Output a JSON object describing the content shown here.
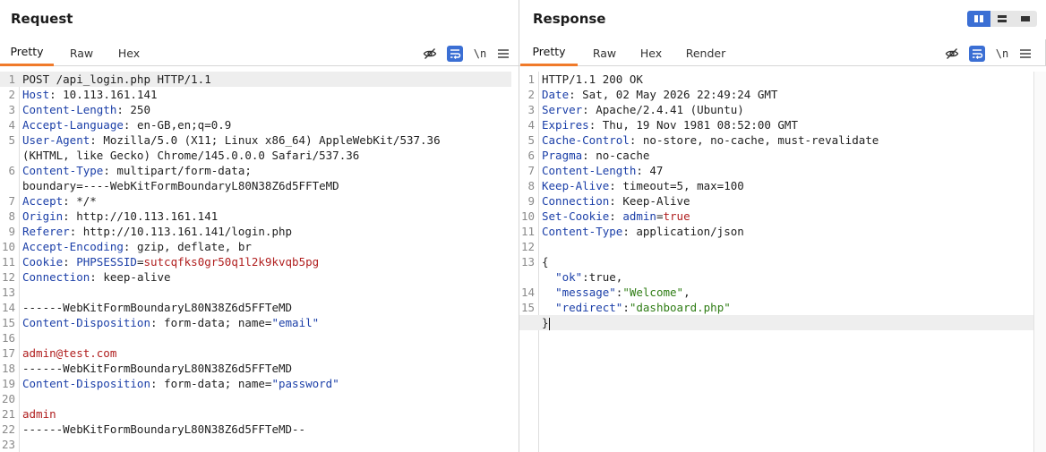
{
  "request": {
    "title": "Request",
    "tabs": [
      "Pretty",
      "Raw",
      "Hex"
    ],
    "active_tab": "Pretty",
    "newline_toggle": "\\n",
    "lines": [
      {
        "n": "1",
        "parts": [
          [
            "POST /api_login.php HTTP/1.1",
            ""
          ]
        ],
        "hl": true
      },
      {
        "n": "2",
        "parts": [
          [
            "Host",
            "hn"
          ],
          [
            ": 10.113.161.141",
            ""
          ]
        ]
      },
      {
        "n": "3",
        "parts": [
          [
            "Content-Length",
            "hn"
          ],
          [
            ": 250",
            ""
          ]
        ]
      },
      {
        "n": "4",
        "parts": [
          [
            "Accept-Language",
            "hn"
          ],
          [
            ": en-GB,en;q=0.9",
            ""
          ]
        ]
      },
      {
        "n": "5",
        "parts": [
          [
            "User-Agent",
            "hn"
          ],
          [
            ": Mozilla/5.0 (X11; Linux x86_64) AppleWebKit/537.36",
            ""
          ]
        ]
      },
      {
        "n": "",
        "parts": [
          [
            "(KHTML, like Gecko) Chrome/145.0.0.0 Safari/537.36",
            ""
          ]
        ]
      },
      {
        "n": "6",
        "parts": [
          [
            "Content-Type",
            "hn"
          ],
          [
            ": multipart/form-data;",
            ""
          ]
        ]
      },
      {
        "n": "",
        "parts": [
          [
            "boundary=----WebKitFormBoundaryL80N38Z6d5FFTeMD",
            ""
          ]
        ]
      },
      {
        "n": "7",
        "parts": [
          [
            "Accept",
            "hn"
          ],
          [
            ": */*",
            ""
          ]
        ]
      },
      {
        "n": "8",
        "parts": [
          [
            "Origin",
            "hn"
          ],
          [
            ": http://10.113.161.141",
            ""
          ]
        ]
      },
      {
        "n": "9",
        "parts": [
          [
            "Referer",
            "hn"
          ],
          [
            ": http://10.113.161.141/login.php",
            ""
          ]
        ]
      },
      {
        "n": "10",
        "parts": [
          [
            "Accept-Encoding",
            "hn"
          ],
          [
            ": gzip, deflate, br",
            ""
          ]
        ]
      },
      {
        "n": "11",
        "parts": [
          [
            "Cookie",
            "hn"
          ],
          [
            ": ",
            ""
          ],
          [
            "PHPSESSID",
            "hn"
          ],
          [
            "=",
            ""
          ],
          [
            "sutcqfks0gr50q1l2k9kvqb5pg",
            "r"
          ]
        ]
      },
      {
        "n": "12",
        "parts": [
          [
            "Connection",
            "hn"
          ],
          [
            ": keep-alive",
            ""
          ]
        ]
      },
      {
        "n": "13",
        "parts": [
          [
            "",
            ""
          ]
        ]
      },
      {
        "n": "14",
        "parts": [
          [
            "------WebKitFormBoundaryL80N38Z6d5FFTeMD",
            ""
          ]
        ]
      },
      {
        "n": "15",
        "parts": [
          [
            "Content-Disposition",
            "hn"
          ],
          [
            ": form-data; name=",
            ""
          ],
          [
            "\"email\"",
            "q"
          ]
        ]
      },
      {
        "n": "16",
        "parts": [
          [
            "",
            ""
          ]
        ]
      },
      {
        "n": "17",
        "parts": [
          [
            "admin@test.com",
            "r"
          ]
        ]
      },
      {
        "n": "18",
        "parts": [
          [
            "------WebKitFormBoundaryL80N38Z6d5FFTeMD",
            ""
          ]
        ]
      },
      {
        "n": "19",
        "parts": [
          [
            "Content-Disposition",
            "hn"
          ],
          [
            ": form-data; name=",
            ""
          ],
          [
            "\"password\"",
            "q"
          ]
        ]
      },
      {
        "n": "20",
        "parts": [
          [
            "",
            ""
          ]
        ]
      },
      {
        "n": "21",
        "parts": [
          [
            "admin",
            "r"
          ]
        ]
      },
      {
        "n": "22",
        "parts": [
          [
            "------WebKitFormBoundaryL80N38Z6d5FFTeMD--",
            ""
          ]
        ]
      },
      {
        "n": "23",
        "parts": [
          [
            "",
            ""
          ]
        ]
      }
    ]
  },
  "response": {
    "title": "Response",
    "tabs": [
      "Pretty",
      "Raw",
      "Hex",
      "Render"
    ],
    "active_tab": "Pretty",
    "newline_toggle": "\\n",
    "lines": [
      {
        "n": "1",
        "parts": [
          [
            "HTTP/1.1 200 OK",
            ""
          ]
        ]
      },
      {
        "n": "2",
        "parts": [
          [
            "Date",
            "hn"
          ],
          [
            ": Sat, 02 May 2026 22:49:24 GMT",
            ""
          ]
        ]
      },
      {
        "n": "3",
        "parts": [
          [
            "Server",
            "hn"
          ],
          [
            ": Apache/2.4.41 (Ubuntu)",
            ""
          ]
        ]
      },
      {
        "n": "4",
        "parts": [
          [
            "Expires",
            "hn"
          ],
          [
            ": Thu, 19 Nov 1981 08:52:00 GMT",
            ""
          ]
        ]
      },
      {
        "n": "5",
        "parts": [
          [
            "Cache-Control",
            "hn"
          ],
          [
            ": no-store, no-cache, must-revalidate",
            ""
          ]
        ]
      },
      {
        "n": "6",
        "parts": [
          [
            "Pragma",
            "hn"
          ],
          [
            ": no-cache",
            ""
          ]
        ]
      },
      {
        "n": "7",
        "parts": [
          [
            "Content-Length",
            "hn"
          ],
          [
            ": 47",
            ""
          ]
        ]
      },
      {
        "n": "8",
        "parts": [
          [
            "Keep-Alive",
            "hn"
          ],
          [
            ": timeout=5, max=100",
            ""
          ]
        ]
      },
      {
        "n": "9",
        "parts": [
          [
            "Connection",
            "hn"
          ],
          [
            ": Keep-Alive",
            ""
          ]
        ]
      },
      {
        "n": "10",
        "parts": [
          [
            "Set-Cookie",
            "hn"
          ],
          [
            ": ",
            ""
          ],
          [
            "admin",
            "hn"
          ],
          [
            "=",
            ""
          ],
          [
            "true",
            "r"
          ]
        ]
      },
      {
        "n": "11",
        "parts": [
          [
            "Content-Type",
            "hn"
          ],
          [
            ": application/json",
            ""
          ]
        ]
      },
      {
        "n": "12",
        "parts": [
          [
            "",
            ""
          ]
        ]
      },
      {
        "n": "13",
        "parts": [
          [
            "{",
            ""
          ]
        ]
      },
      {
        "n": "",
        "parts": [
          [
            "  ",
            ""
          ],
          [
            "\"ok\"",
            "hn"
          ],
          [
            ":true,",
            ""
          ]
        ]
      },
      {
        "n": "14",
        "parts": [
          [
            "  ",
            ""
          ],
          [
            "\"message\"",
            "hn"
          ],
          [
            ":",
            ""
          ],
          [
            "\"Welcome\"",
            "g"
          ],
          [
            ",",
            ""
          ]
        ]
      },
      {
        "n": "15",
        "parts": [
          [
            "  ",
            ""
          ],
          [
            "\"redirect\"",
            "hn"
          ],
          [
            ":",
            ""
          ],
          [
            "\"dashboard.php\"",
            "g"
          ]
        ]
      },
      {
        "n": "",
        "parts": [
          [
            "}",
            ""
          ]
        ],
        "hl": true,
        "cursor": true
      }
    ]
  },
  "icons": {
    "hide": "eye-slash-icon",
    "wrap": "word-wrap-icon",
    "menu": "hamburger-menu-icon",
    "layout": [
      "split-horizontal-icon",
      "split-vertical-icon",
      "single-pane-icon"
    ]
  },
  "colors": {
    "accent": "#f07a2a",
    "toggle_blue": "#3b6fd4",
    "header_name": "#1b3fa8",
    "value_red": "#b01e1e",
    "string_green": "#2f7d15"
  }
}
